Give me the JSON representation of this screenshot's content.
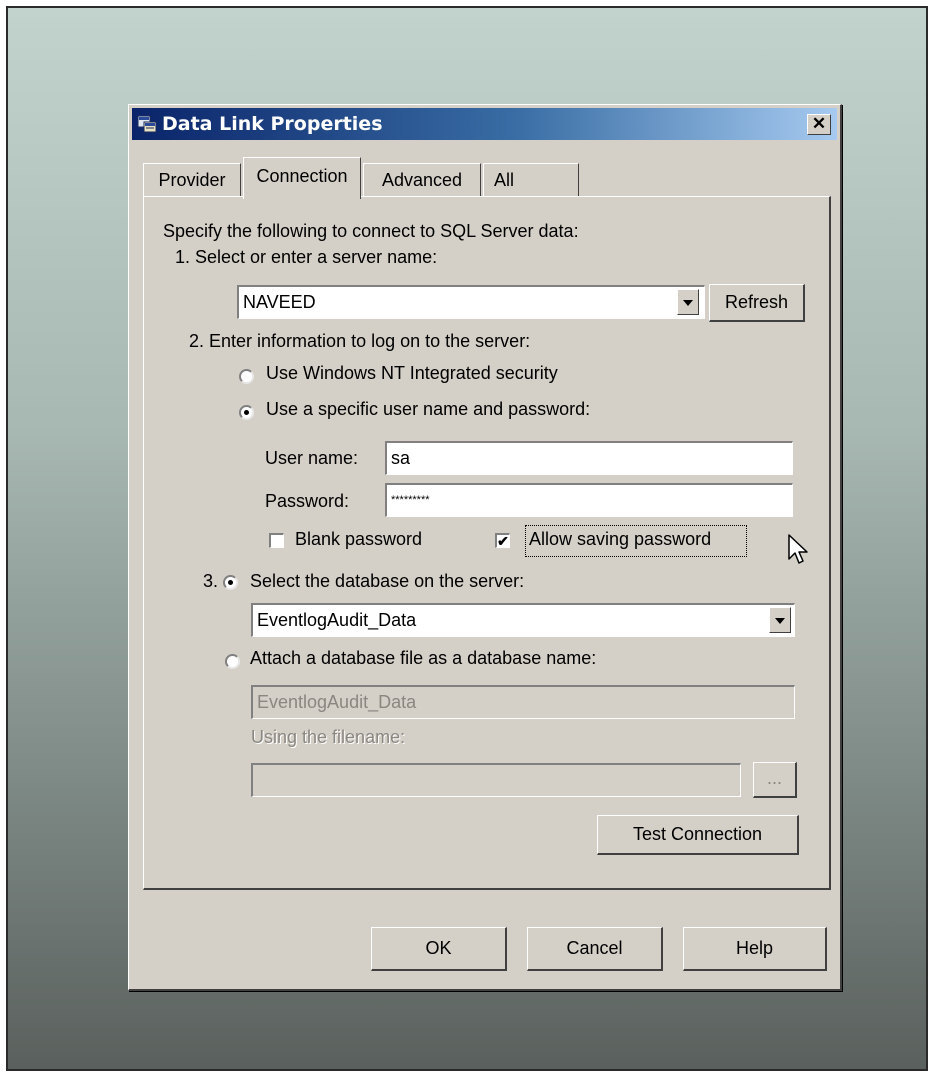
{
  "window": {
    "title": "Data Link Properties",
    "close_glyph": "✕"
  },
  "tabs": [
    {
      "label": "Provider",
      "active": false
    },
    {
      "label": "Connection",
      "active": true
    },
    {
      "label": "Advanced",
      "active": false
    },
    {
      "label": "All",
      "active": false
    }
  ],
  "connection": {
    "intro": "Specify the following to connect to SQL Server data:",
    "step1_label": "1. Select or enter a server name:",
    "server_name": "NAVEED",
    "refresh_label": "Refresh",
    "step2_label": "2. Enter information to log on to the server:",
    "radio_nt_label": "Use Windows NT Integrated security",
    "radio_nt_selected": false,
    "radio_specific_label": "Use a specific user name and password:",
    "radio_specific_selected": true,
    "username_label": "User name:",
    "username_value": "sa",
    "password_label": "Password:",
    "password_value": "*********",
    "blank_password_label": "Blank password",
    "blank_password_checked": false,
    "allow_saving_label": "Allow saving password",
    "allow_saving_checked": true,
    "step3_number": "3.",
    "radio_select_db_label": "Select the database on the server:",
    "radio_select_db_selected": true,
    "database_value": "EventlogAudit_Data",
    "radio_attach_label": "Attach a database file as a database name:",
    "radio_attach_selected": false,
    "attach_name_value": "EventlogAudit_Data",
    "filename_label": "Using the filename:",
    "filename_value": "",
    "browse_label": "...",
    "test_connection_label": "Test Connection"
  },
  "footer": {
    "ok_label": "OK",
    "cancel_label": "Cancel",
    "help_label": "Help"
  },
  "icons": {
    "title_icon": "data-link-icon",
    "cursor": "mouse-pointer-icon"
  },
  "colors": {
    "title_start": "#0a246a",
    "title_end": "#a6caf0",
    "dialog_face": "#d4d0c8"
  }
}
